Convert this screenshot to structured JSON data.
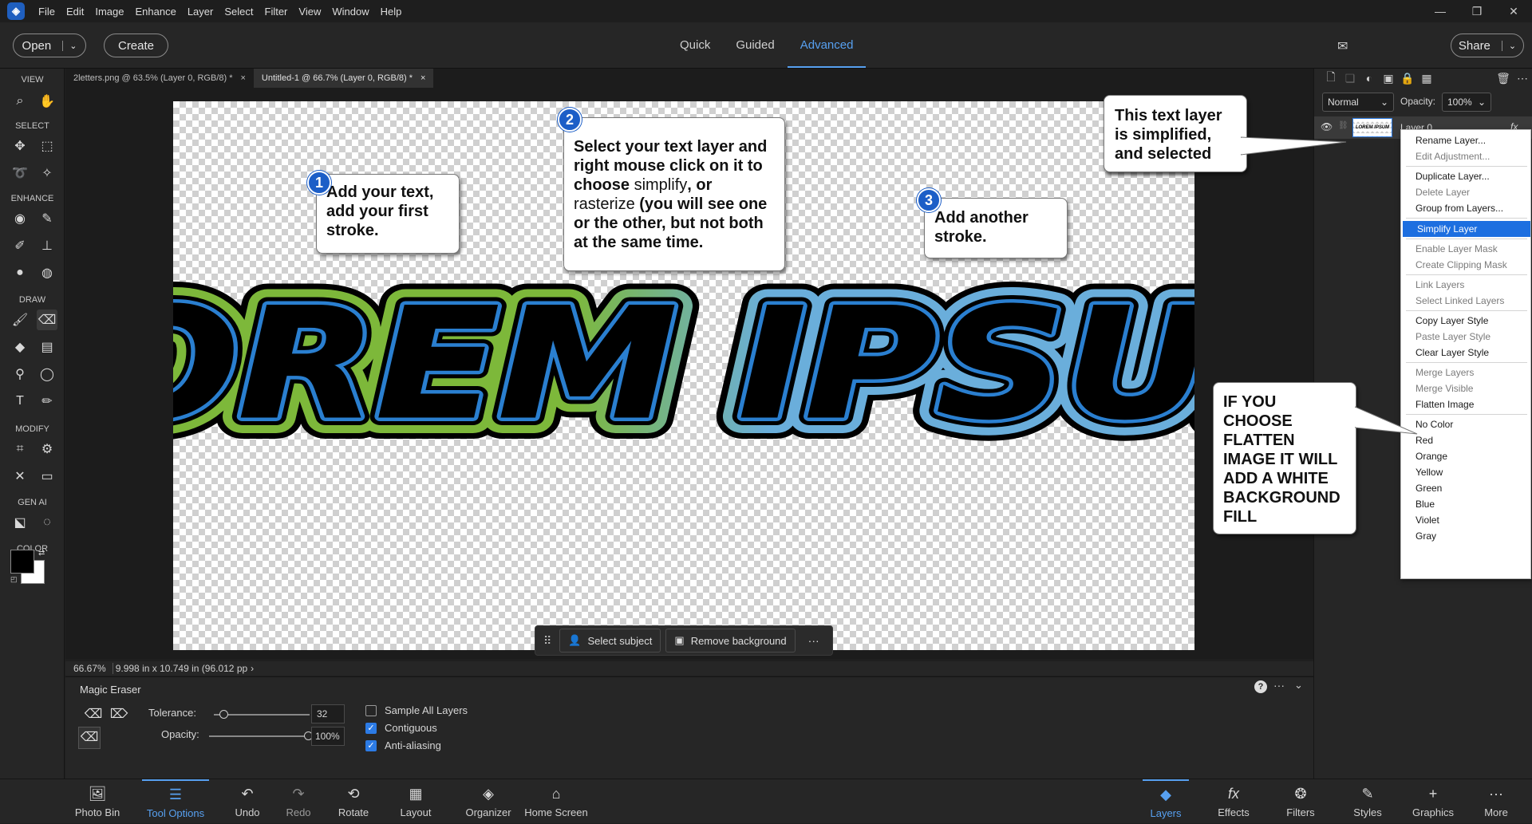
{
  "menubar": {
    "items": [
      "File",
      "Edit",
      "Image",
      "Enhance",
      "Layer",
      "Select",
      "Filter",
      "View",
      "Window",
      "Help"
    ]
  },
  "header": {
    "open_label": "Open",
    "create_label": "Create",
    "modes": [
      "Quick",
      "Guided",
      "Advanced"
    ],
    "active_mode": "Advanced",
    "share_label": "Share"
  },
  "toolbar": {
    "sections": [
      "VIEW",
      "SELECT",
      "ENHANCE",
      "DRAW",
      "MODIFY",
      "GEN AI",
      "COLOR"
    ]
  },
  "doc_tabs": [
    {
      "label": "2letters.png @ 63.5% (Layer 0, RGB/8) *"
    },
    {
      "label": "Untitled-1 @ 66.7% (Layer 0, RGB/8) *"
    }
  ],
  "canvas": {
    "art_text": "LOREM IPSUM",
    "callouts": {
      "c1_number": "1",
      "c1_text": "Add  your text, add your first stroke.",
      "c2_number": "2",
      "c2_text_a": "Select your text layer and right mouse click on it to choose ",
      "c2_text_b": "simplify",
      "c2_text_c": ", or ",
      "c2_text_d": "rasterize",
      "c2_text_e": " (you will see one or the other, but not both at the same time.",
      "c3_number": "3",
      "c3_text": "Add another stroke.",
      "c4_text": "This text layer is simplified, and selected",
      "c5_text": "IF YOU CHOOSE FLATTEN IMAGE IT WILL ADD A WHITE BACKGROUND  FILL"
    }
  },
  "floatbar": {
    "select_subject": "Select subject",
    "remove_background": "Remove background",
    "more": "···"
  },
  "status": {
    "zoom": "66.67%",
    "dimensions": "9.998 in x 10.749 in (96.012 pp",
    "arrow": "›"
  },
  "tool_options": {
    "tool_name": "Magic Eraser",
    "tolerance_label": "Tolerance:",
    "tolerance_value": "32",
    "tolerance_level": 0.1,
    "opacity_label": "Opacity:",
    "opacity_value": "100%",
    "opacity_level": 1.0,
    "sample_all_layers": "Sample All Layers",
    "contiguous": "Contiguous",
    "anti_aliasing": "Anti-aliasing"
  },
  "bottombar": {
    "left": [
      "Photo Bin",
      "Tool Options",
      "Undo",
      "Redo",
      "Rotate",
      "Layout",
      "Organizer",
      "Home Screen"
    ],
    "right": [
      "Layers",
      "Effects",
      "Filters",
      "Styles",
      "Graphics",
      "More"
    ]
  },
  "layers_panel": {
    "blend_mode": "Normal",
    "opacity_label": "Opacity:",
    "opacity_value": "100%",
    "layer_name": "Layer 0",
    "thumb_text": "LOREM IPSUM"
  },
  "context_menu": {
    "items": [
      {
        "label": "Rename Layer...",
        "state": "enabled"
      },
      {
        "label": "Edit Adjustment...",
        "state": "disabled"
      },
      {
        "label": "Duplicate Layer...",
        "state": "enabled"
      },
      {
        "label": "Delete Layer",
        "state": "disabled"
      },
      {
        "label": "Group from Layers...",
        "state": "enabled"
      },
      {
        "label": "Simplify Layer",
        "state": "highlighted"
      },
      {
        "label": "Enable Layer Mask",
        "state": "disabled"
      },
      {
        "label": "Create Clipping Mask",
        "state": "disabled"
      },
      {
        "label": "Link Layers",
        "state": "disabled"
      },
      {
        "label": "Select Linked Layers",
        "state": "disabled"
      },
      {
        "label": "Copy Layer Style",
        "state": "enabled"
      },
      {
        "label": "Paste Layer Style",
        "state": "disabled"
      },
      {
        "label": "Clear Layer Style",
        "state": "enabled"
      },
      {
        "label": "Merge Layers",
        "state": "disabled"
      },
      {
        "label": "Merge Visible",
        "state": "disabled"
      },
      {
        "label": "Flatten Image",
        "state": "enabled"
      },
      {
        "label": "No Color",
        "state": "enabled"
      },
      {
        "label": "Red",
        "state": "enabled"
      },
      {
        "label": "Orange",
        "state": "enabled"
      },
      {
        "label": "Yellow",
        "state": "enabled"
      },
      {
        "label": "Green",
        "state": "enabled"
      },
      {
        "label": "Blue",
        "state": "enabled"
      },
      {
        "label": "Violet",
        "state": "enabled"
      },
      {
        "label": "Gray",
        "state": "enabled"
      }
    ]
  },
  "colors": {
    "accent": "#57a0f0",
    "menu_highlight": "#1d6fe0",
    "text_fill": "#000000",
    "inner_stroke": "#2a7fd0",
    "outer_stroke_left": "#7db83a",
    "outer_stroke_right": "#6aaedb"
  }
}
